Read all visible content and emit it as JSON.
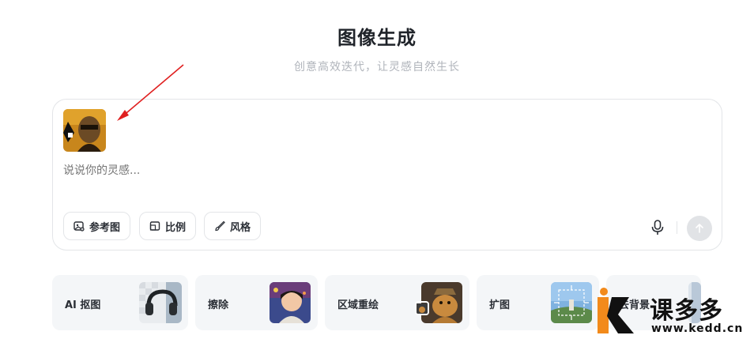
{
  "header": {
    "title": "图像生成",
    "subtitle": "创意高效迭代，让灵感自然生长"
  },
  "composer": {
    "reference_image": "reference-portrait",
    "placeholder": "说说你的灵感...",
    "chips": [
      {
        "label": "参考图",
        "icon": "image-add-icon"
      },
      {
        "label": "比例",
        "icon": "aspect-ratio-icon"
      },
      {
        "label": "风格",
        "icon": "brush-icon"
      }
    ],
    "mic_icon": "microphone-icon",
    "send_icon": "arrow-up-icon"
  },
  "tools": [
    {
      "label": "AI 抠图"
    },
    {
      "label": "擦除"
    },
    {
      "label": "区域重绘"
    },
    {
      "label": "扩图"
    },
    {
      "label": "去背景"
    }
  ],
  "watermark": {
    "name": "课多多",
    "url": "www.kedd.cn"
  },
  "colors": {
    "arrow": "#e02020",
    "brand_orange": "#f28a1b",
    "send_disabled": "#e1e3e6"
  }
}
